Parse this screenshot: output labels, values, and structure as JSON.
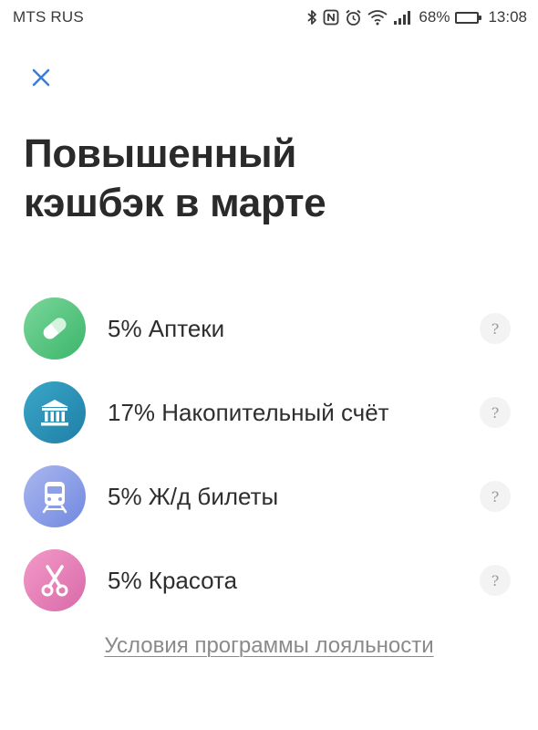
{
  "status_bar": {
    "carrier": "MTS RUS",
    "battery": "68%",
    "battery_level": 0.68,
    "time": "13:08",
    "icons": [
      "bluetooth-icon",
      "nfc-icon",
      "alarm-icon",
      "wifi-icon",
      "signal-icon",
      "battery-icon"
    ]
  },
  "header": {
    "close_icon": "close-icon",
    "title_line1": "Повышенный",
    "title_line2": "кэшбэк в марте"
  },
  "cashback": {
    "items": [
      {
        "label": "5% Аптеки",
        "icon": "pill-icon",
        "colors": [
          "#7ad79a",
          "#3cb56b"
        ],
        "help": "?"
      },
      {
        "label": "17% Накопительный счёт",
        "icon": "bank-icon",
        "colors": [
          "#3aa6c8",
          "#1f7fa6"
        ],
        "help": "?"
      },
      {
        "label": "5% Ж/д билеты",
        "icon": "train-icon",
        "colors": [
          "#a9b7ef",
          "#7288e0"
        ],
        "help": "?"
      },
      {
        "label": "5% Красота",
        "icon": "scissors-icon",
        "colors": [
          "#f29ac8",
          "#d96aa8"
        ],
        "help": "?"
      }
    ]
  },
  "footer": {
    "link": "Условия программы лояльности"
  },
  "colors": {
    "accent": "#3b7ed8",
    "text": "#2b2b2b",
    "muted": "#8a8a8a"
  }
}
